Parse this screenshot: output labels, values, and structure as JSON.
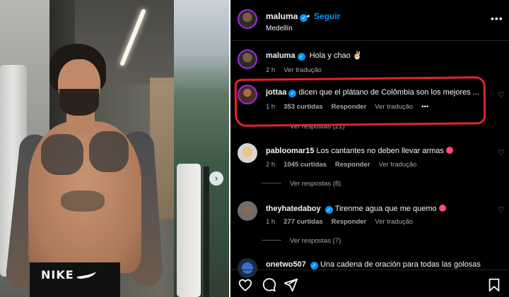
{
  "post": {
    "author": "maluma",
    "follow_label": "Seguir",
    "location": "Medellín",
    "more_icon": "more-options-icon",
    "photo_brand": "NIKE"
  },
  "comments": [
    {
      "user": "maluma",
      "verified": true,
      "text": "Hola y chao ✌🏻",
      "time": "2 h",
      "likes": "",
      "reply": "",
      "translate": "Ver tradução",
      "replies": ""
    },
    {
      "user": "jottaa",
      "verified": true,
      "text": "dicen que el plátano de Colômbia son los mejores ...",
      "time": "1 h",
      "likes": "353 curtidas",
      "reply": "Responder",
      "translate": "Ver tradução",
      "more": "•••",
      "replies": "Ver respostas (21)"
    },
    {
      "user": "pabloomar15",
      "verified": false,
      "text": "Los cantantes no deben llevar armas",
      "time": "2 h",
      "likes": "1045 curtidas",
      "reply": "Responder",
      "translate": "Ver tradução",
      "replies": "Ver respostas (8)"
    },
    {
      "user": "theyhatedaboy",
      "verified": false,
      "text": "Tirenme agua que me quemo",
      "time": "1 h",
      "likes": "277 curtidas",
      "reply": "Responder",
      "translate": "Ver tradução",
      "replies": "Ver respostas (7)"
    },
    {
      "user": "onetwo507",
      "verified": false,
      "text": "Una cadena de oración para todas las golosas",
      "time": "",
      "likes": "",
      "reply": "",
      "translate": "",
      "replies": ""
    }
  ],
  "actions": {
    "like_icon": "heart-icon",
    "comment_icon": "comment-icon",
    "share_icon": "share-icon",
    "save_icon": "bookmark-icon"
  },
  "colors": {
    "panel_bg": "#000000",
    "link_blue": "#0095f6",
    "highlight_red": "#e3232b",
    "meta_gray": "#a8a8a8"
  }
}
